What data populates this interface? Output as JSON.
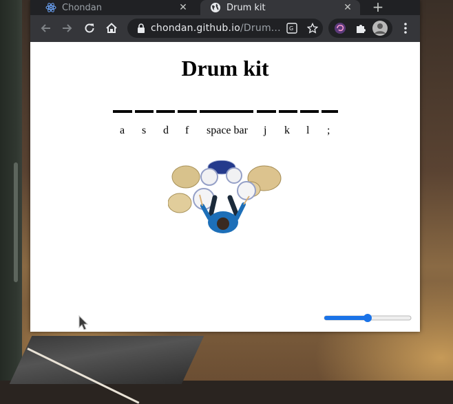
{
  "browser": {
    "tabs": [
      {
        "title": "Chondan",
        "active": false,
        "favicon": "react-atom-icon"
      },
      {
        "title": "Drum kit",
        "active": true,
        "favicon": "globe-icon"
      }
    ],
    "url_host": "chondan.github.io",
    "url_path": "/Drum...",
    "colors": {
      "frame": "#202124",
      "toolbar": "#35363a",
      "accent": "#1a73e8"
    }
  },
  "page": {
    "title": "Drum kit",
    "keys": [
      "a",
      "s",
      "d",
      "f",
      "space bar",
      "j",
      "k",
      "l",
      ";"
    ],
    "volume": 0.5
  }
}
